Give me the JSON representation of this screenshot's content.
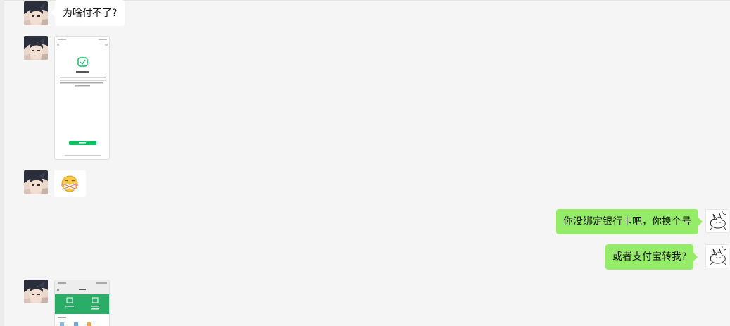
{
  "messages": [
    {
      "side": "in",
      "type": "text",
      "text": "为啥付不了?"
    },
    {
      "side": "in",
      "type": "image",
      "image": "phone-screenshot-verify"
    },
    {
      "side": "in",
      "type": "sticker",
      "sticker": "zipped-mouth-emoji"
    },
    {
      "side": "out",
      "type": "text",
      "text": "你没绑定银行卡吧，你换个号"
    },
    {
      "side": "out",
      "type": "text",
      "text": "或者支付宝转我?"
    },
    {
      "side": "in",
      "type": "image",
      "image": "phone-screenshot-wallet"
    }
  ],
  "colors": {
    "background": "#f5f5f5",
    "incoming_bubble": "#ffffff",
    "outgoing_bubble": "#95ec69",
    "wechat_green": "#07c160",
    "text": "#111111"
  }
}
